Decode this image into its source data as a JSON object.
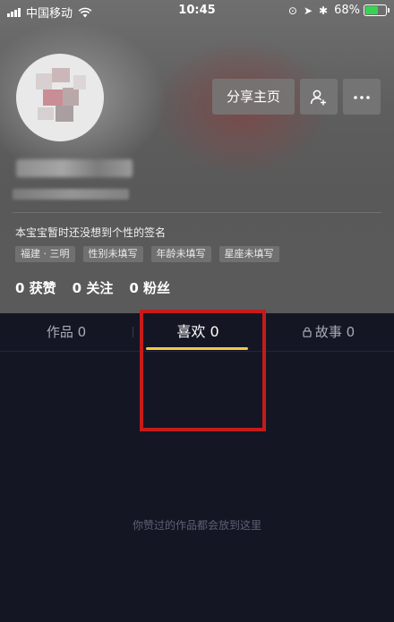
{
  "status_bar": {
    "carrier": "中国移动",
    "time": "10:45",
    "battery": "68%",
    "battery_level": 0.68
  },
  "profile": {
    "share_label": "分享主页",
    "signature": "本宝宝暂时还没想到个性的签名",
    "tags": [
      "福建 · 三明",
      "性别未填写",
      "年龄未填写",
      "星座未填写"
    ],
    "stats": {
      "likes": "0 获赞",
      "following": "0 关注",
      "followers": "0 粉丝"
    }
  },
  "tabs": {
    "works": "作品 0",
    "likes": "喜欢 0",
    "stories": "故事 0"
  },
  "empty_hint": "你赞过的作品都会放到这里",
  "colors": {
    "accent_underline": "#f5c84b",
    "highlight": "#c51b1b",
    "background": "#151624"
  }
}
